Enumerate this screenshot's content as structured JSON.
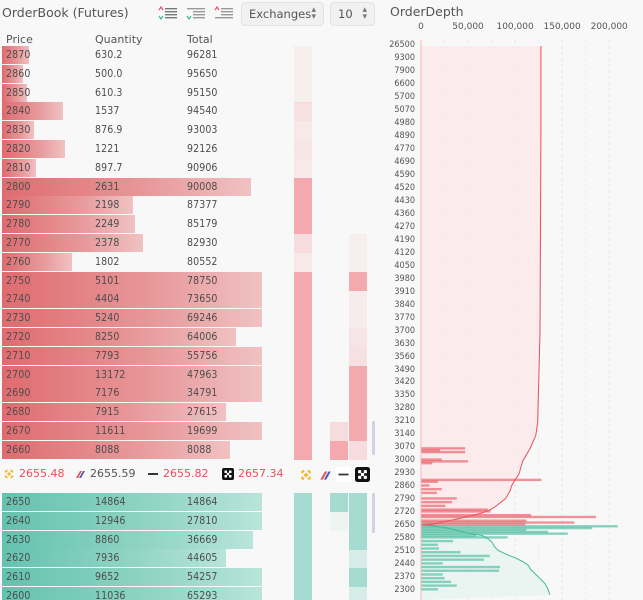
{
  "orderbook": {
    "title": "OrderBook (Futures)",
    "toolbar": {
      "icons": [
        "orderbook-both-icon",
        "orderbook-bids-icon",
        "orderbook-asks-icon"
      ],
      "exchange_select": "Exchanges",
      "depth_select": "10"
    },
    "columns": [
      "Price",
      "Quantity",
      "Total"
    ],
    "asks": [
      {
        "price": "2870",
        "qty": "630.2",
        "total": "96281",
        "bar": 0.07,
        "c1": 0.05,
        "c2": null,
        "c3": null
      },
      {
        "price": "2860",
        "qty": "500.0",
        "total": "95650",
        "bar": 0.055,
        "c1": 0.04,
        "c2": null,
        "c3": null
      },
      {
        "price": "2850",
        "qty": "610.3",
        "total": "95150",
        "bar": 0.065,
        "c1": 0.04,
        "c2": null,
        "c3": null
      },
      {
        "price": "2840",
        "qty": "1537",
        "total": "94540",
        "bar": 0.16,
        "c1": 0.3,
        "c2": null,
        "c3": null
      },
      {
        "price": "2830",
        "qty": "876.9",
        "total": "93003",
        "bar": 0.085,
        "c1": 0.2,
        "c2": null,
        "c3": null
      },
      {
        "price": "2820",
        "qty": "1221",
        "total": "92126",
        "bar": 0.165,
        "c1": 0.25,
        "c2": null,
        "c3": null
      },
      {
        "price": "2810",
        "qty": "897.7",
        "total": "90906",
        "bar": 0.09,
        "c1": 0.18,
        "c2": null,
        "c3": null
      },
      {
        "price": "2800",
        "qty": "2631",
        "total": "90008",
        "bar": 0.655,
        "c1": 1,
        "c2": null,
        "c3": null
      },
      {
        "price": "2790",
        "qty": "2198",
        "total": "87377",
        "bar": 0.345,
        "c1": 1,
        "c2": null,
        "c3": null
      },
      {
        "price": "2780",
        "qty": "2249",
        "total": "85179",
        "bar": 0.35,
        "c1": 1,
        "c2": null,
        "c3": null
      },
      {
        "price": "2770",
        "qty": "2378",
        "total": "82930",
        "bar": 0.37,
        "c1": 0.35,
        "c2": null,
        "c3": 0.06
      },
      {
        "price": "2760",
        "qty": "1802",
        "total": "80552",
        "bar": 0.185,
        "c1": 0.2,
        "c2": null,
        "c3": 0.06
      },
      {
        "price": "2750",
        "qty": "5101",
        "total": "78750",
        "bar": 0.685,
        "c1": 1,
        "c2": null,
        "c3": 1
      },
      {
        "price": "2740",
        "qty": "4404",
        "total": "73650",
        "bar": 0.685,
        "c1": 1,
        "c2": null,
        "c3": 0.15
      },
      {
        "price": "2730",
        "qty": "5240",
        "total": "69246",
        "bar": 0.685,
        "c1": 1,
        "c2": null,
        "c3": 0.15
      },
      {
        "price": "2720",
        "qty": "8250",
        "total": "64006",
        "bar": 0.615,
        "c1": 1,
        "c2": null,
        "c3": 0.25
      },
      {
        "price": "2710",
        "qty": "7793",
        "total": "55756",
        "bar": 0.685,
        "c1": 1,
        "c2": null,
        "c3": 0.3
      },
      {
        "price": "2700",
        "qty": "13172",
        "total": "47963",
        "bar": 0.685,
        "c1": 1,
        "c2": null,
        "c3": 1
      },
      {
        "price": "2690",
        "qty": "7176",
        "total": "34791",
        "bar": 0.685,
        "c1": 1,
        "c2": null,
        "c3": 1
      },
      {
        "price": "2680",
        "qty": "7915",
        "total": "27615",
        "bar": 0.59,
        "c1": 1,
        "c2": null,
        "c3": 1
      },
      {
        "price": "2670",
        "qty": "11611",
        "total": "19699",
        "bar": 0.685,
        "c1": 1,
        "c2": 0.35,
        "c3": 1
      },
      {
        "price": "2660",
        "qty": "8088",
        "total": "8088",
        "bar": 0.6,
        "c1": 1,
        "c2": 1,
        "c3": 0.35
      }
    ],
    "exchange_prices": [
      {
        "exchange": "binance",
        "icon": "binance-logo-icon",
        "price": "2655.48",
        "color": "#e8505b"
      },
      {
        "exchange": "bitmex",
        "icon": "bitmex-logo-icon",
        "price": "2655.59",
        "color": "#555555"
      },
      {
        "exchange": "bybit",
        "icon": "bybit-logo-icon",
        "price": "2655.82",
        "color": "#e8505b"
      },
      {
        "exchange": "okx",
        "icon": "okx-logo-icon",
        "price": "2657.34",
        "color": "#e8505b"
      }
    ],
    "bids": [
      {
        "price": "2650",
        "qty": "14864",
        "total": "14864",
        "bar": 0.685,
        "c1": 1,
        "c2": 1,
        "c3": 1
      },
      {
        "price": "2640",
        "qty": "12946",
        "total": "27810",
        "bar": 0.685,
        "c1": 1,
        "c2": 0.05,
        "c3": 1
      },
      {
        "price": "2630",
        "qty": "8860",
        "total": "36669",
        "bar": 0.66,
        "c1": 1,
        "c2": null,
        "c3": 1
      },
      {
        "price": "2620",
        "qty": "7936",
        "total": "44605",
        "bar": 0.59,
        "c1": 1,
        "c2": null,
        "c3": 0.4
      },
      {
        "price": "2610",
        "qty": "9652",
        "total": "54257",
        "bar": 0.685,
        "c1": 1,
        "c2": null,
        "c3": 1
      },
      {
        "price": "2600",
        "qty": "11036",
        "total": "65293",
        "bar": 0.685,
        "c1": 1,
        "c2": null,
        "c3": 0.4
      }
    ],
    "colors": {
      "ask": "#f4a9ae",
      "bid": "#a5dbd0"
    }
  },
  "depth": {
    "title": "OrderDepth",
    "chart_data": {
      "type": "bar",
      "title": "OrderDepth",
      "orientation": "horizontal",
      "xlim": [
        0,
        220000
      ],
      "x_ticks": [
        "0",
        "50,000",
        "100,000",
        "150,000",
        "200,000"
      ],
      "x_tick_values": [
        0,
        50000,
        100000,
        150000,
        200000
      ],
      "y_ticks": [
        "26500",
        "9300",
        "7900",
        "6600",
        "5700",
        "5070",
        "4980",
        "4890",
        "4770",
        "4690",
        "4590",
        "4520",
        "4430",
        "4360",
        "4270",
        "4190",
        "4120",
        "4050",
        "3980",
        "3910",
        "3840",
        "3770",
        "3700",
        "3630",
        "3560",
        "3490",
        "3420",
        "3350",
        "3280",
        "3210",
        "3140",
        "3070",
        "3000",
        "2930",
        "2860",
        "2790",
        "2720",
        "2650",
        "2580",
        "2510",
        "2440",
        "2370",
        "2300"
      ],
      "grid": true,
      "ask_cumulative_max": 127500,
      "series": [
        {
          "name": "asks",
          "color": "#e8505b",
          "levels": [
            {
              "price": 3070,
              "qty": 47000
            },
            {
              "price": 3060,
              "qty": 20000
            },
            {
              "price": 3050,
              "qty": 47000
            },
            {
              "price": 3010,
              "qty": 22000
            },
            {
              "price": 3000,
              "qty": 50000
            },
            {
              "price": 2990,
              "qty": 12000
            },
            {
              "price": 2900,
              "qty": 128000
            },
            {
              "price": 2890,
              "qty": 18000
            },
            {
              "price": 2870,
              "qty": 9000
            },
            {
              "price": 2850,
              "qty": 22000
            },
            {
              "price": 2830,
              "qty": 17000
            },
            {
              "price": 2800,
              "qty": 38000
            },
            {
              "price": 2780,
              "qty": 33000
            },
            {
              "price": 2760,
              "qty": 26000
            },
            {
              "price": 2740,
              "qty": 71000
            },
            {
              "price": 2730,
              "qty": 74000
            },
            {
              "price": 2710,
              "qty": 117000
            },
            {
              "price": 2700,
              "qty": 186000
            },
            {
              "price": 2680,
              "qty": 112000
            },
            {
              "price": 2670,
              "qty": 163000
            },
            {
              "price": 2660,
              "qty": 111000
            }
          ]
        },
        {
          "name": "bids",
          "color": "#3fb89a",
          "levels": [
            {
              "price": 2650,
              "qty": 209000
            },
            {
              "price": 2640,
              "qty": 182000
            },
            {
              "price": 2630,
              "qty": 112000
            },
            {
              "price": 2620,
              "qty": 135000
            },
            {
              "price": 2610,
              "qty": 156000
            },
            {
              "price": 2600,
              "qty": 59000
            },
            {
              "price": 2590,
              "qty": 92000
            },
            {
              "price": 2570,
              "qty": 34000
            },
            {
              "price": 2550,
              "qty": 18000
            },
            {
              "price": 2530,
              "qty": 19000
            },
            {
              "price": 2510,
              "qty": 42000
            },
            {
              "price": 2490,
              "qty": 73000
            },
            {
              "price": 2470,
              "qty": 67000
            },
            {
              "price": 2450,
              "qty": 23000
            },
            {
              "price": 2430,
              "qty": 84000
            },
            {
              "price": 2410,
              "qty": 83000
            },
            {
              "price": 2390,
              "qty": 23000
            },
            {
              "price": 2370,
              "qty": 25000
            },
            {
              "price": 2350,
              "qty": 32000
            },
            {
              "price": 2330,
              "qty": 38000
            },
            {
              "price": 2310,
              "qty": 18000
            }
          ]
        }
      ]
    }
  }
}
